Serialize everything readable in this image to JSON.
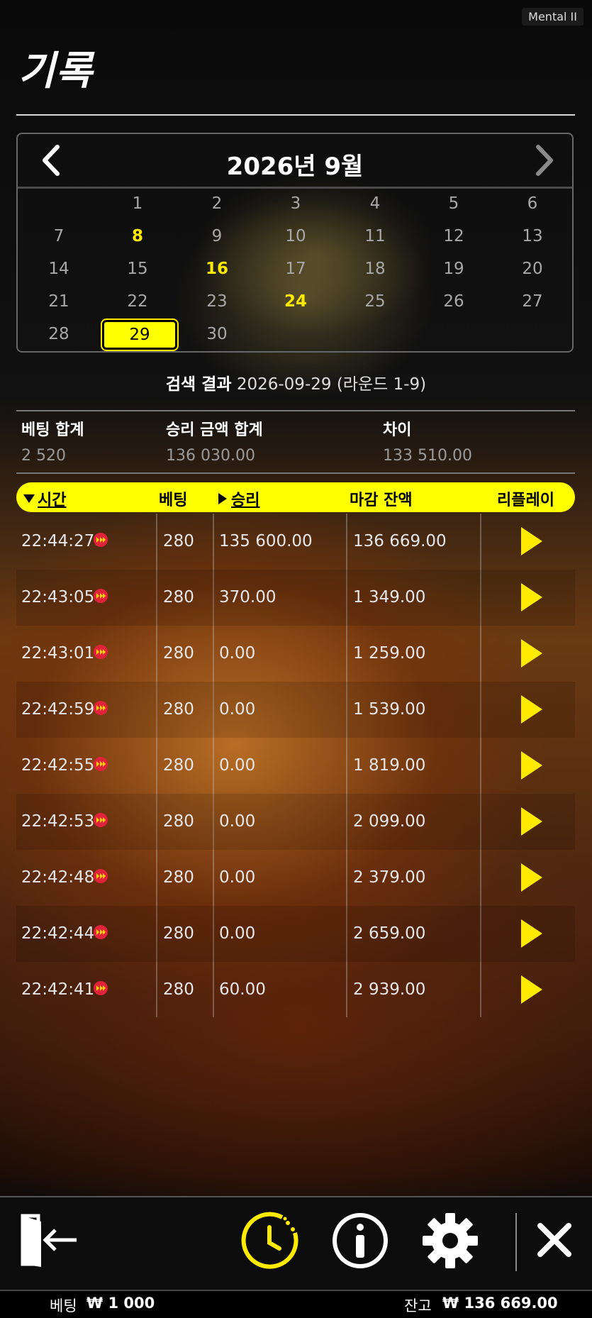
{
  "app_badge": "Mental II",
  "page_title": "기록",
  "calendar": {
    "title": "2026년 9월",
    "days": [
      {
        "label": "1",
        "col": 1,
        "row": 0,
        "highlight": false,
        "selected": false
      },
      {
        "label": "2",
        "col": 2,
        "row": 0,
        "highlight": false,
        "selected": false
      },
      {
        "label": "3",
        "col": 3,
        "row": 0,
        "highlight": false,
        "selected": false
      },
      {
        "label": "4",
        "col": 4,
        "row": 0,
        "highlight": false,
        "selected": false
      },
      {
        "label": "5",
        "col": 5,
        "row": 0,
        "highlight": false,
        "selected": false
      },
      {
        "label": "6",
        "col": 6,
        "row": 0,
        "highlight": false,
        "selected": false
      },
      {
        "label": "7",
        "col": 0,
        "row": 1,
        "highlight": false,
        "selected": false
      },
      {
        "label": "8",
        "col": 1,
        "row": 1,
        "highlight": true,
        "selected": false
      },
      {
        "label": "9",
        "col": 2,
        "row": 1,
        "highlight": false,
        "selected": false
      },
      {
        "label": "10",
        "col": 3,
        "row": 1,
        "highlight": false,
        "selected": false
      },
      {
        "label": "11",
        "col": 4,
        "row": 1,
        "highlight": false,
        "selected": false
      },
      {
        "label": "12",
        "col": 5,
        "row": 1,
        "highlight": false,
        "selected": false
      },
      {
        "label": "13",
        "col": 6,
        "row": 1,
        "highlight": false,
        "selected": false
      },
      {
        "label": "14",
        "col": 0,
        "row": 2,
        "highlight": false,
        "selected": false
      },
      {
        "label": "15",
        "col": 1,
        "row": 2,
        "highlight": false,
        "selected": false
      },
      {
        "label": "16",
        "col": 2,
        "row": 2,
        "highlight": true,
        "selected": false
      },
      {
        "label": "17",
        "col": 3,
        "row": 2,
        "highlight": false,
        "selected": false
      },
      {
        "label": "18",
        "col": 4,
        "row": 2,
        "highlight": false,
        "selected": false
      },
      {
        "label": "19",
        "col": 5,
        "row": 2,
        "highlight": false,
        "selected": false
      },
      {
        "label": "20",
        "col": 6,
        "row": 2,
        "highlight": false,
        "selected": false
      },
      {
        "label": "21",
        "col": 0,
        "row": 3,
        "highlight": false,
        "selected": false
      },
      {
        "label": "22",
        "col": 1,
        "row": 3,
        "highlight": false,
        "selected": false
      },
      {
        "label": "23",
        "col": 2,
        "row": 3,
        "highlight": false,
        "selected": false
      },
      {
        "label": "24",
        "col": 3,
        "row": 3,
        "highlight": true,
        "selected": false
      },
      {
        "label": "25",
        "col": 4,
        "row": 3,
        "highlight": false,
        "selected": false
      },
      {
        "label": "26",
        "col": 5,
        "row": 3,
        "highlight": false,
        "selected": false
      },
      {
        "label": "27",
        "col": 6,
        "row": 3,
        "highlight": false,
        "selected": false
      },
      {
        "label": "28",
        "col": 0,
        "row": 4,
        "highlight": false,
        "selected": false
      },
      {
        "label": "29",
        "col": 1,
        "row": 4,
        "highlight": false,
        "selected": true
      },
      {
        "label": "30",
        "col": 2,
        "row": 4,
        "highlight": false,
        "selected": false
      }
    ]
  },
  "search": {
    "label": "검색 결과",
    "value": "2026-09-29 (라운드 1-9)"
  },
  "summary": {
    "bet_total_label": "베팅 합계",
    "bet_total": "2 520",
    "win_total_label": "승리 금액 합계",
    "win_total": "136 030.00",
    "diff_label": "차이",
    "diff": "133 510.00"
  },
  "table": {
    "headers": {
      "time": "시간",
      "bet": "베팅",
      "win": "승리",
      "balance": "마감 잔액",
      "replay": "리플레이"
    },
    "rows": [
      {
        "time": "22:44:27",
        "bet": "280",
        "win": "135 600.00",
        "balance": "136 669.00"
      },
      {
        "time": "22:43:05",
        "bet": "280",
        "win": "370.00",
        "balance": "1 349.00"
      },
      {
        "time": "22:43:01",
        "bet": "280",
        "win": "0.00",
        "balance": "1 259.00"
      },
      {
        "time": "22:42:59",
        "bet": "280",
        "win": "0.00",
        "balance": "1 539.00"
      },
      {
        "time": "22:42:55",
        "bet": "280",
        "win": "0.00",
        "balance": "1 819.00"
      },
      {
        "time": "22:42:53",
        "bet": "280",
        "win": "0.00",
        "balance": "2 099.00"
      },
      {
        "time": "22:42:48",
        "bet": "280",
        "win": "0.00",
        "balance": "2 379.00"
      },
      {
        "time": "22:42:44",
        "bet": "280",
        "win": "0.00",
        "balance": "2 659.00"
      },
      {
        "time": "22:42:41",
        "bet": "280",
        "win": "60.00",
        "balance": "2 939.00"
      }
    ]
  },
  "toolbar": {
    "icons": [
      "exit-icon",
      "history-clock-icon",
      "info-icon",
      "settings-gear-icon",
      "close-icon"
    ],
    "accent": "#ffea00"
  },
  "status": {
    "bet_label": "베팅",
    "bet_value": "₩ 1 000",
    "balance_label": "잔고",
    "balance_value": "₩ 136 669.00"
  }
}
